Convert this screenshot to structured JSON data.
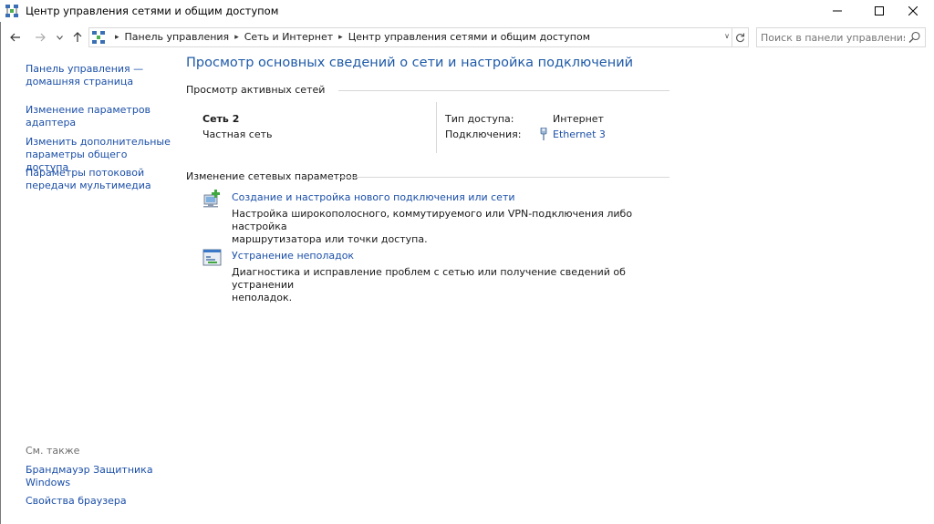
{
  "window": {
    "title": "Центр управления сетями и общим доступом",
    "app_icon": "network-center-icon"
  },
  "address_bar": {
    "breadcrumbs": [
      "Панель управления",
      "Сеть и Интернет",
      "Центр управления сетями и общим доступом"
    ],
    "search_placeholder": "Поиск в панели управления"
  },
  "left_pane": {
    "links": [
      {
        "line1": "Панель управления —",
        "line2": "домашняя страница"
      },
      {
        "line1": "Изменение параметров",
        "line2": "адаптера"
      },
      {
        "line1": "Изменить дополнительные",
        "line2": "параметры общего доступа"
      },
      {
        "line1": "Параметры потоковой",
        "line2": "передачи мультимедиа"
      }
    ],
    "see_also_label": "См. также",
    "see_also": [
      {
        "line1": "Брандмауэр Защитника",
        "line2": "Windows"
      },
      {
        "line1": "Свойства браузера",
        "line2": ""
      }
    ]
  },
  "main": {
    "title": "Просмотр основных сведений о сети и настройка подключений",
    "active_networks_header": "Просмотр активных сетей",
    "network": {
      "name": "Сеть 2",
      "category": "Частная сеть",
      "access_type_label": "Тип доступа:",
      "access_type_value": "Интернет",
      "connections_label": "Подключения:",
      "connection_value": "Ethernet 3"
    },
    "change_settings_header": "Изменение сетевых параметров",
    "tasks": [
      {
        "icon": "new-connection-icon",
        "link": "Создание и настройка нового подключения или сети",
        "desc_line1": "Настройка широкополосного, коммутируемого или VPN-подключения либо настройка",
        "desc_line2": "маршрутизатора или точки доступа."
      },
      {
        "icon": "troubleshoot-icon",
        "link": "Устранение неполадок",
        "desc_line1": "Диагностика и исправление проблем с сетью или получение сведений об устранении",
        "desc_line2": "неполадок."
      }
    ]
  },
  "colors": {
    "link": "#1b4fa8",
    "title": "#1e5aa8",
    "muted": "#6d6d6d"
  }
}
